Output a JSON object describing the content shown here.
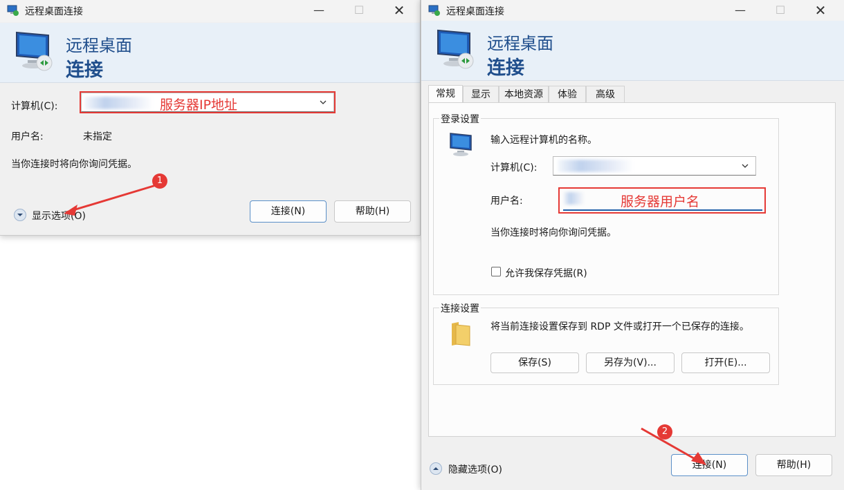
{
  "window_title": "远程桌面连接",
  "header": {
    "line1": "远程桌面",
    "line2": "连接"
  },
  "left": {
    "computer_label": "计算机(C):",
    "computer_note": "服务器IP地址",
    "username_label": "用户名:",
    "username_value": "未指定",
    "credential_note": "当你连接时将向你询问凭据。",
    "show_options": "显示选项(O)",
    "connect_button": "连接(N)",
    "help_button": "帮助(H)",
    "badge": "1"
  },
  "right": {
    "tabs": [
      "常规",
      "显示",
      "本地资源",
      "体验",
      "高级"
    ],
    "login_group_title": "登录设置",
    "login_prompt": "输入远程计算机的名称。",
    "computer_label": "计算机(C):",
    "username_label": "用户名:",
    "username_note": "服务器用户名",
    "credential_note": "当你连接时将向你询问凭据。",
    "allow_save_label": "允许我保存凭据(R)",
    "conn_group_title": "连接设置",
    "conn_desc": "将当前连接设置保存到 RDP 文件或打开一个已保存的连接。",
    "save_button": "保存(S)",
    "save_as_button": "另存为(V)...",
    "open_button": "打开(E)...",
    "hide_options": "隐藏选项(O)",
    "connect_button": "连接(N)",
    "help_button": "帮助(H)",
    "badge": "2"
  },
  "icons": {
    "minimize": "minimize-icon",
    "maximize": "maximize-icon",
    "close": "close-icon",
    "app": "remote-desktop-icon",
    "folder": "folder-icon"
  },
  "colors": {
    "annotation": "#e53935",
    "brand_text": "#1f4e8c"
  }
}
